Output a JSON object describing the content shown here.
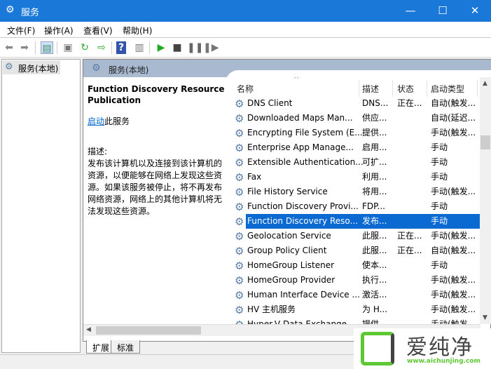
{
  "window": {
    "title": "服务",
    "icon": "services-gear-icon",
    "controls": {
      "minimize": "—",
      "maximize": "☐",
      "close": "✕"
    }
  },
  "menu": [
    "文件(F)",
    "操作(A)",
    "查看(V)",
    "帮助(H)"
  ],
  "toolbar": {
    "icons": [
      "back-arrow-icon",
      "forward-arrow-icon",
      "show-hide-tree-icon",
      "properties-icon",
      "refresh-icon",
      "export-list-icon",
      "help-icon",
      "action-pane-icon",
      "start-icon",
      "stop-icon",
      "pause-icon",
      "resume-icon"
    ]
  },
  "tree": {
    "item": "服务(本地)"
  },
  "pane_header": "服务(本地)",
  "detail": {
    "service_name": "Function Discovery Resource Publication",
    "start_link": "启动",
    "start_suffix": "此服务",
    "desc_label": "描述:",
    "description": "发布该计算机以及连接到该计算机的资源，以便能够在网络上发现这些资源。如果该服务被停止，将不再发布网络资源，网络上的其他计算机将无法发现这些资源。"
  },
  "columns": [
    "名称",
    "描述",
    "状态",
    "启动类型"
  ],
  "rows": [
    {
      "name": "DNS Client",
      "desc": "DNS...",
      "status": "正在...",
      "startup": "自动(触发..."
    },
    {
      "name": "Downloaded Maps Man...",
      "desc": "供应...",
      "status": "",
      "startup": "自动(延迟..."
    },
    {
      "name": "Encrypting File System (E...",
      "desc": "提供...",
      "status": "",
      "startup": "手动(触发..."
    },
    {
      "name": "Enterprise App Manage...",
      "desc": "启用...",
      "status": "",
      "startup": "手动"
    },
    {
      "name": "Extensible Authentication...",
      "desc": "可扩...",
      "status": "",
      "startup": "手动"
    },
    {
      "name": "Fax",
      "desc": "利用...",
      "status": "",
      "startup": "手动"
    },
    {
      "name": "File History Service",
      "desc": "将用...",
      "status": "",
      "startup": "手动(触发..."
    },
    {
      "name": "Function Discovery Provi...",
      "desc": "FDP...",
      "status": "",
      "startup": "手动"
    },
    {
      "name": "Function Discovery Reso...",
      "desc": "发布...",
      "status": "",
      "startup": "手动",
      "selected": true
    },
    {
      "name": "Geolocation Service",
      "desc": "此服...",
      "status": "正在...",
      "startup": "手动(触发..."
    },
    {
      "name": "Group Policy Client",
      "desc": "此服...",
      "status": "正在...",
      "startup": "自动(触发..."
    },
    {
      "name": "HomeGroup Listener",
      "desc": "使本...",
      "status": "",
      "startup": "手动"
    },
    {
      "name": "HomeGroup Provider",
      "desc": "执行...",
      "status": "",
      "startup": "手动(触发..."
    },
    {
      "name": "Human Interface Device ...",
      "desc": "激活...",
      "status": "",
      "startup": "手动(触发..."
    },
    {
      "name": "HV 主机服务",
      "desc": "为 H...",
      "status": "",
      "startup": "手动(触发..."
    },
    {
      "name": "Hyper-V Data Exchange ...",
      "desc": "提供...",
      "status": "",
      "startup": "手动(触发..."
    }
  ],
  "tabs": [
    "扩展",
    "标准"
  ],
  "watermark": {
    "brand": "爱纯净",
    "url": "www.aichunjing.com",
    "color": "#5cc832"
  },
  "colors": {
    "titlebar": "#1a78d8",
    "selection": "#0a6ad2",
    "pane_header": "#a8b9d0"
  }
}
